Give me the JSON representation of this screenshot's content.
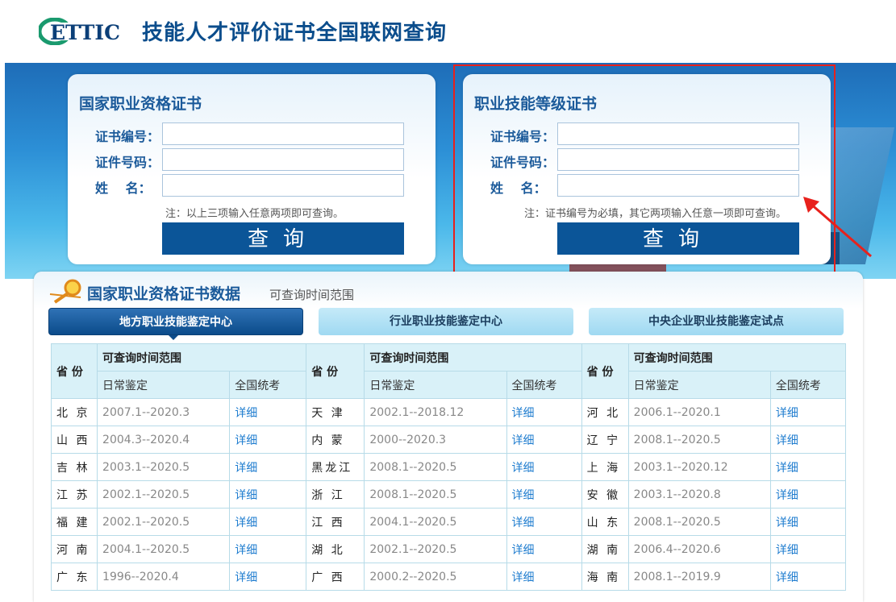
{
  "header": {
    "logo_text": "ETTIC",
    "title": "技能人才评价证书全国联网查询"
  },
  "card_left": {
    "title": "国家职业资格证书",
    "fields": [
      "证书编号：",
      "证件号码：",
      "姓　 名："
    ],
    "note": "注：以上三项输入任意两项即可查询。",
    "button": "查询"
  },
  "card_right": {
    "title": "职业技能等级证书",
    "fields": [
      "证书编号：",
      "证件号码：",
      "姓　 名："
    ],
    "note": "注：证书编号为必填，其它两项输入任意一项即可查询。",
    "button": "查询"
  },
  "panel": {
    "title": "国家职业资格证书数据",
    "subtitle": "可查询时间范围",
    "tabs": [
      "地方职业技能鉴定中心",
      "行业职业技能鉴定中心",
      "中央企业职业技能鉴定试点"
    ]
  },
  "table": {
    "province_header": "省 份",
    "range_header": "可查询时间范围",
    "daily_header": "日常鉴定",
    "national_header": "全国统考",
    "link_label": "详细",
    "rows": [
      [
        [
          "北 京",
          "2007.1--2020.3"
        ],
        [
          "天 津",
          "2002.1--2018.12"
        ],
        [
          "河 北",
          "2006.1--2020.1"
        ]
      ],
      [
        [
          "山 西",
          "2004.3--2020.4"
        ],
        [
          "内 蒙",
          "2000--2020.3"
        ],
        [
          "辽 宁",
          "2008.1--2020.5"
        ]
      ],
      [
        [
          "吉 林",
          "2003.1--2020.5"
        ],
        [
          "黑龙江",
          "2008.1--2020.5"
        ],
        [
          "上 海",
          "2003.1--2020.12"
        ]
      ],
      [
        [
          "江 苏",
          "2002.1--2020.5"
        ],
        [
          "浙 江",
          "2008.1--2020.5"
        ],
        [
          "安 徽",
          "2003.1--2020.8"
        ]
      ],
      [
        [
          "福 建",
          "2002.1--2020.5"
        ],
        [
          "江 西",
          "2004.1--2020.5"
        ],
        [
          "山 东",
          "2008.1--2020.5"
        ]
      ],
      [
        [
          "河 南",
          "2004.1--2020.5"
        ],
        [
          "湖 北",
          "2002.1--2020.5"
        ],
        [
          "湖 南",
          "2006.4--2020.6"
        ]
      ],
      [
        [
          "广 东",
          "1996--2020.4"
        ],
        [
          "广 西",
          "2000.2--2020.5"
        ],
        [
          "海 南",
          "2008.1--2019.9"
        ]
      ]
    ]
  },
  "colors": {
    "brand_blue": "#0b5598",
    "highlight_red": "#e8211c",
    "link_blue": "#1e7ccf"
  }
}
